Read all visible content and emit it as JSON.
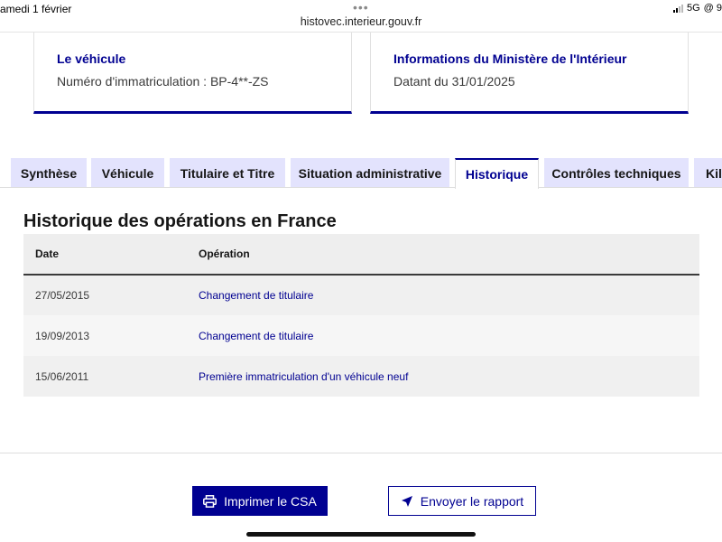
{
  "status_bar": {
    "date": "amedi 1 février",
    "url": "histovec.interieur.gouv.fr",
    "network": "5G",
    "right_glyphs": "@ 9"
  },
  "cards": {
    "vehicle": {
      "title": "Le véhicule",
      "text": "Numéro d'immatriculation : BP-4**-ZS"
    },
    "ministry": {
      "title": "Informations du Ministère de l'Intérieur",
      "text": "Datant du 31/01/2025"
    }
  },
  "tabs": [
    {
      "label": "Synthèse"
    },
    {
      "label": "Véhicule"
    },
    {
      "label": "Titulaire et Titre"
    },
    {
      "label": "Situation administrative"
    },
    {
      "label": "Historique"
    },
    {
      "label": "Contrôles techniques"
    },
    {
      "label": "Kilo"
    }
  ],
  "active_tab": "Historique",
  "history": {
    "title": "Historique des opérations en France",
    "columns": [
      "Date",
      "Opération"
    ],
    "rows": [
      {
        "date": "27/05/2015",
        "operation": "Changement de titulaire"
      },
      {
        "date": "19/09/2013",
        "operation": "Changement de titulaire"
      },
      {
        "date": "15/06/2011",
        "operation": "Première immatriculation d'un véhicule neuf"
      }
    ]
  },
  "actions": {
    "print_label": "Imprimer le CSA",
    "send_label": "Envoyer le rapport"
  },
  "colors": {
    "primary": "#000091",
    "tab_bg": "#e3e3fd"
  },
  "icons": {
    "print": "printer-icon",
    "send": "send-icon"
  }
}
